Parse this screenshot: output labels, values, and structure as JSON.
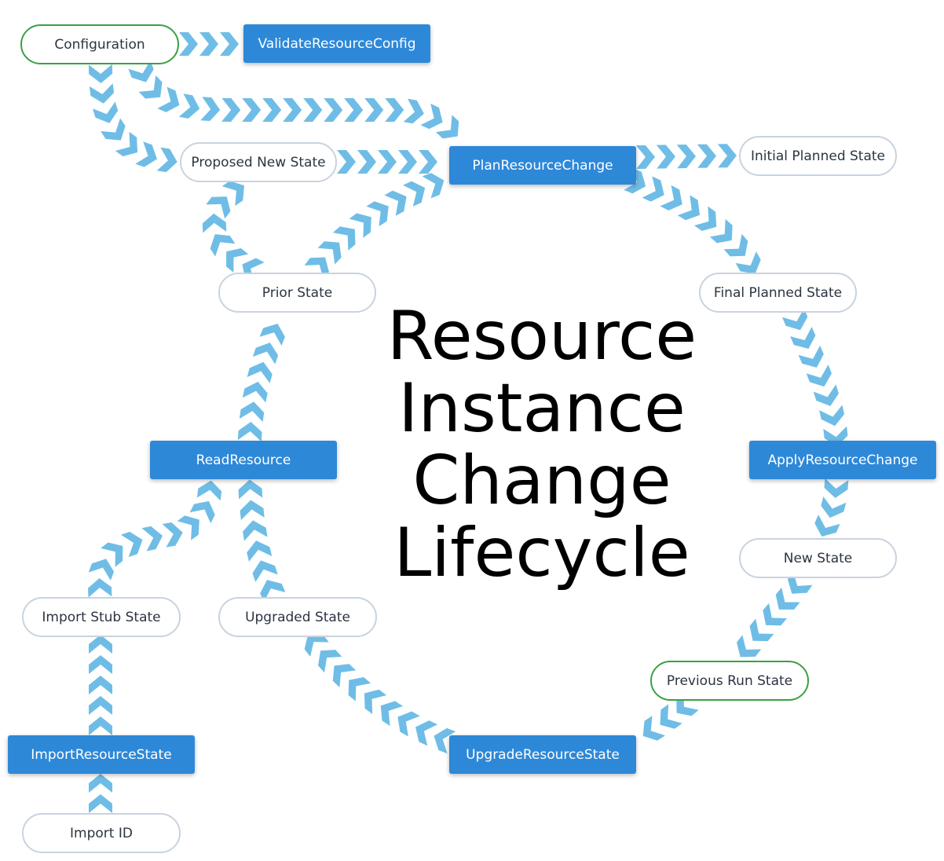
{
  "title": {
    "lines": [
      "Resource",
      "Instance",
      "Change",
      "Lifecycle"
    ]
  },
  "colors": {
    "arrow": "#6fbde6",
    "function_box": "#2e88d8",
    "state_border": "#c9d3de",
    "input_state_border": "#3aa043"
  },
  "nodes": {
    "configuration": {
      "label": "Configuration",
      "kind": "input-state"
    },
    "validate_resource_config": {
      "label": "ValidateResourceConfig",
      "kind": "function"
    },
    "proposed_new_state": {
      "label": "Proposed New State",
      "kind": "state"
    },
    "plan_resource_change": {
      "label": "PlanResourceChange",
      "kind": "function"
    },
    "initial_planned_state": {
      "label": "Initial Planned State",
      "kind": "state"
    },
    "prior_state": {
      "label": "Prior State",
      "kind": "state"
    },
    "final_planned_state": {
      "label": "Final Planned State",
      "kind": "state"
    },
    "read_resource": {
      "label": "ReadResource",
      "kind": "function"
    },
    "apply_resource_change": {
      "label": "ApplyResourceChange",
      "kind": "function"
    },
    "new_state": {
      "label": "New State",
      "kind": "state"
    },
    "import_stub_state": {
      "label": "Import Stub State",
      "kind": "state"
    },
    "upgraded_state": {
      "label": "Upgraded State",
      "kind": "state"
    },
    "previous_run_state": {
      "label": "Previous Run State",
      "kind": "input-state"
    },
    "import_resource_state": {
      "label": "ImportResourceState",
      "kind": "function"
    },
    "upgrade_resource_state": {
      "label": "UpgradeResourceState",
      "kind": "function"
    },
    "import_id": {
      "label": "Import ID",
      "kind": "input-state-plain"
    }
  },
  "edges": [
    {
      "from": "configuration",
      "to": "validate_resource_config"
    },
    {
      "from": "configuration",
      "to": "plan_resource_change"
    },
    {
      "from": "configuration",
      "to": "proposed_new_state"
    },
    {
      "from": "proposed_new_state",
      "to": "plan_resource_change"
    },
    {
      "from": "plan_resource_change",
      "to": "initial_planned_state"
    },
    {
      "from": "plan_resource_change",
      "to": "final_planned_state"
    },
    {
      "from": "prior_state",
      "to": "proposed_new_state"
    },
    {
      "from": "prior_state",
      "to": "plan_resource_change"
    },
    {
      "from": "read_resource",
      "to": "prior_state"
    },
    {
      "from": "final_planned_state",
      "to": "apply_resource_change"
    },
    {
      "from": "apply_resource_change",
      "to": "new_state"
    },
    {
      "from": "new_state",
      "to": "previous_run_state"
    },
    {
      "from": "previous_run_state",
      "to": "upgrade_resource_state"
    },
    {
      "from": "upgrade_resource_state",
      "to": "upgraded_state"
    },
    {
      "from": "upgraded_state",
      "to": "read_resource"
    },
    {
      "from": "import_stub_state",
      "to": "read_resource"
    },
    {
      "from": "import_resource_state",
      "to": "import_stub_state"
    },
    {
      "from": "import_id",
      "to": "import_resource_state"
    }
  ]
}
